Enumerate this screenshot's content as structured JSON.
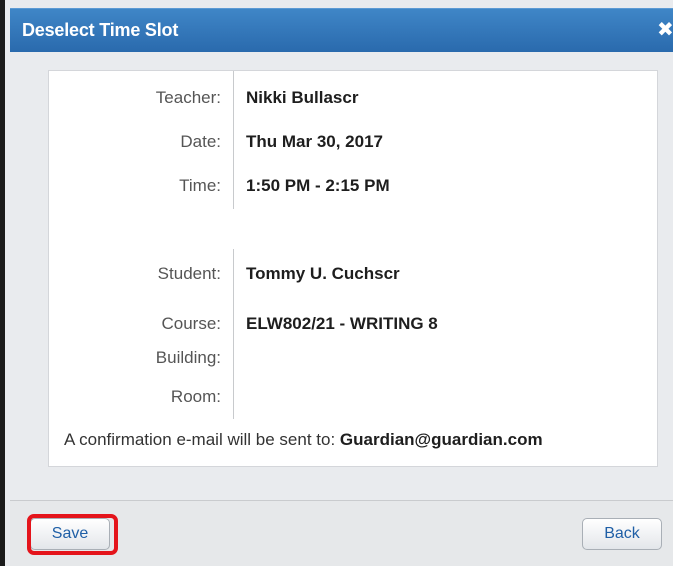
{
  "dialog": {
    "title": "Deselect Time Slot",
    "close_icon": "close-icon"
  },
  "details": {
    "teacher": {
      "label": "Teacher:",
      "value": "Nikki Bullascr"
    },
    "date": {
      "label": "Date:",
      "value": "Thu Mar 30, 2017"
    },
    "time": {
      "label": "Time:",
      "value": "1:50 PM - 2:15 PM"
    },
    "student": {
      "label": "Student:",
      "value": "Tommy U. Cuchscr"
    },
    "course": {
      "label": "Course:",
      "value": "ELW802/21 - WRITING 8"
    },
    "building": {
      "label": "Building:",
      "value": ""
    },
    "room": {
      "label": "Room:",
      "value": ""
    }
  },
  "confirmation": {
    "text": "A confirmation e-mail will be sent to: ",
    "email": "Guardian@guardian.com"
  },
  "footer": {
    "save_label": "Save",
    "back_label": "Back"
  },
  "colors": {
    "titlebar": "#2f74b8",
    "highlight": "#e4141b",
    "button_text": "#1f5fa6"
  }
}
